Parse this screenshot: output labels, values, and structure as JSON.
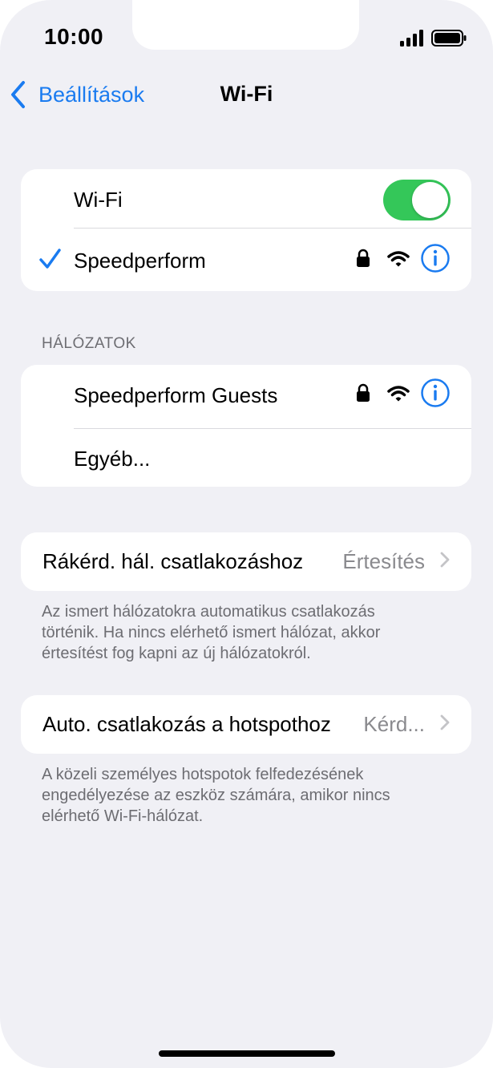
{
  "status": {
    "time": "10:00"
  },
  "nav": {
    "back_label": "Beállítások",
    "title": "Wi-Fi"
  },
  "wifi_group": {
    "toggle_label": "Wi-Fi",
    "toggle_on": true,
    "connected_network": "Speedperform"
  },
  "networks": {
    "header": "HÁLÓZATOK",
    "items": [
      {
        "name": "Speedperform Guests"
      },
      {
        "name": "Egyéb..."
      }
    ]
  },
  "ask_join": {
    "label": "Rákérd. hál. csatlakozáshoz",
    "value": "Értesítés",
    "footer": "Az ismert hálózatokra automatikus csatlakozás történik. Ha nincs elérhető ismert hálózat, akkor értesítést fog kapni az új hálózatokról."
  },
  "auto_hotspot": {
    "label": "Auto. csatlakozás a hotspothoz",
    "value": "Kérd...",
    "footer": "A közeli személyes hotspotok felfedezésének engedélyezése az eszköz számára, amikor nincs elérhető Wi-Fi-hálózat."
  },
  "colors": {
    "accent": "#1a7bf0",
    "toggle_on": "#34c759",
    "background": "#f0f0f5"
  }
}
